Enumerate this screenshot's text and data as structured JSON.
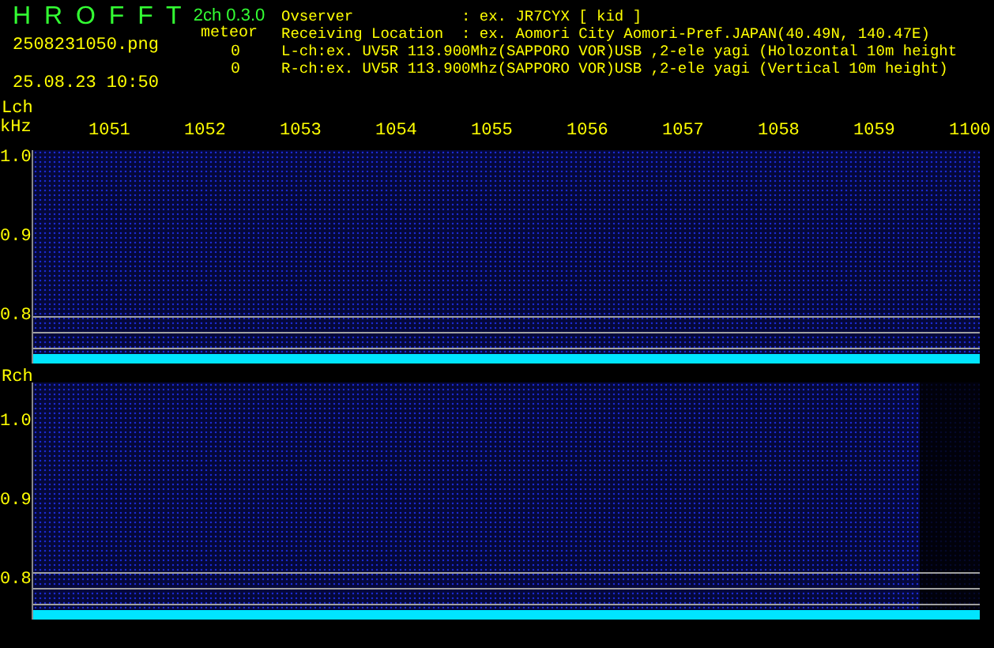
{
  "header": {
    "app_title": "H R O F F T",
    "version": "2ch 0.3.0",
    "mode_label": "meteor",
    "filename": "2508231050.png",
    "datetime": "25.08.23 10:50",
    "counts": [
      "0",
      "0"
    ],
    "info_fields": [
      {
        "label": "Ovserver",
        "value": ": ex. JR7CYX [ kid ]"
      },
      {
        "label": "Receiving Location",
        "value": ": ex. Aomori City Aomori-Pref.JAPAN(40.49N, 140.47E)"
      }
    ],
    "channel_lines": [
      "L-ch:ex. UV5R 113.900Mhz(SAPPORO VOR)USB ,2-ele yagi (Holozontal 10m height",
      "R-ch:ex. UV5R 113.900Mhz(SAPPORO VOR)USB ,2-ele yagi (Vertical 10m height)"
    ]
  },
  "channels": [
    {
      "label": "Lch",
      "unit": "kHz",
      "time_labels": [
        "1051",
        "1052",
        "1053",
        "1054",
        "1055",
        "1056",
        "1057",
        "1058",
        "1059",
        "1100"
      ],
      "y_labels": [
        "1.0",
        "0.9",
        "0.8"
      ]
    },
    {
      "label": "Rch",
      "y_labels": [
        "1.0",
        "0.9",
        "0.8"
      ]
    }
  ]
}
